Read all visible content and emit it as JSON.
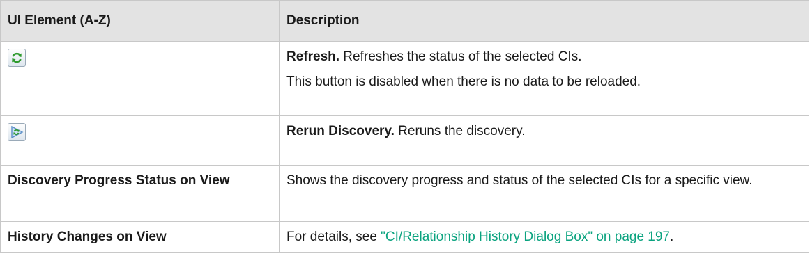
{
  "table": {
    "headers": {
      "element": "UI Element (A-Z)",
      "description": "Description"
    },
    "rows": [
      {
        "element_icon": "refresh-icon",
        "lead": "Refresh.",
        "description": " Refreshes the status of the selected CIs.",
        "note": "This button is disabled when there is no data to be reloaded."
      },
      {
        "element_icon": "rerun-discovery-icon",
        "lead": "Rerun Discovery.",
        "description": " Reruns the discovery."
      },
      {
        "element": "Discovery Progress Status on View",
        "description": "Shows the discovery progress and status of the selected CIs for a specific view."
      },
      {
        "element": "History Changes on View",
        "description_prefix": "For details, see ",
        "link": "\"CI/Relationship History Dialog Box\" on page 197",
        "description_suffix": "."
      }
    ]
  },
  "colors": {
    "header_bg": "#e3e3e3",
    "border": "#c8c8c8",
    "link": "#0aa37f"
  }
}
